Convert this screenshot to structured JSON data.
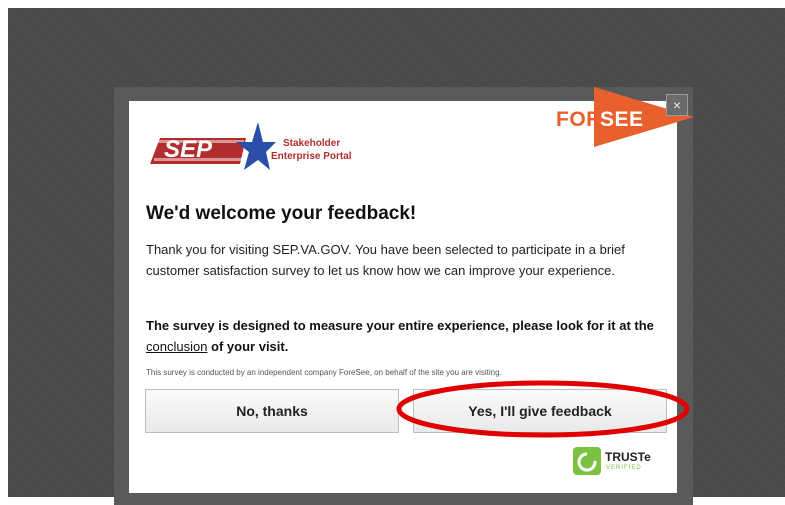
{
  "brand": {
    "foresee_fore": "FORE",
    "foresee_see": "SEE",
    "sep_logo_text": "SEP",
    "sep_subtitle_line1": "Stakeholder",
    "sep_subtitle_line2": "Enterprise Portal"
  },
  "dialog": {
    "close_label": "×",
    "title": "We'd welcome your feedback!",
    "intro": "Thank you for visiting SEP.VA.GOV. You have been selected to participate in a brief customer satisfaction survey to let us know how we can improve your experience.",
    "emphasis_before": "The survey is designed to measure your entire experience, please look for it at the ",
    "emphasis_link": "conclusion",
    "emphasis_after": " of your visit.",
    "disclaimer": "This survey is conducted by an independent company ForeSee, on behalf of the site you are visiting.",
    "no_button": "No, thanks",
    "yes_button": "Yes, I'll give feedback"
  },
  "truste": {
    "label": "TRUSTe",
    "sublabel": "VERIFIED"
  },
  "colors": {
    "foresee_orange": "#e8602d",
    "sep_red": "#b22d2d",
    "sep_blue": "#2b4fa8",
    "annotation_red": "#e00000",
    "truste_green": "#7cc242"
  }
}
